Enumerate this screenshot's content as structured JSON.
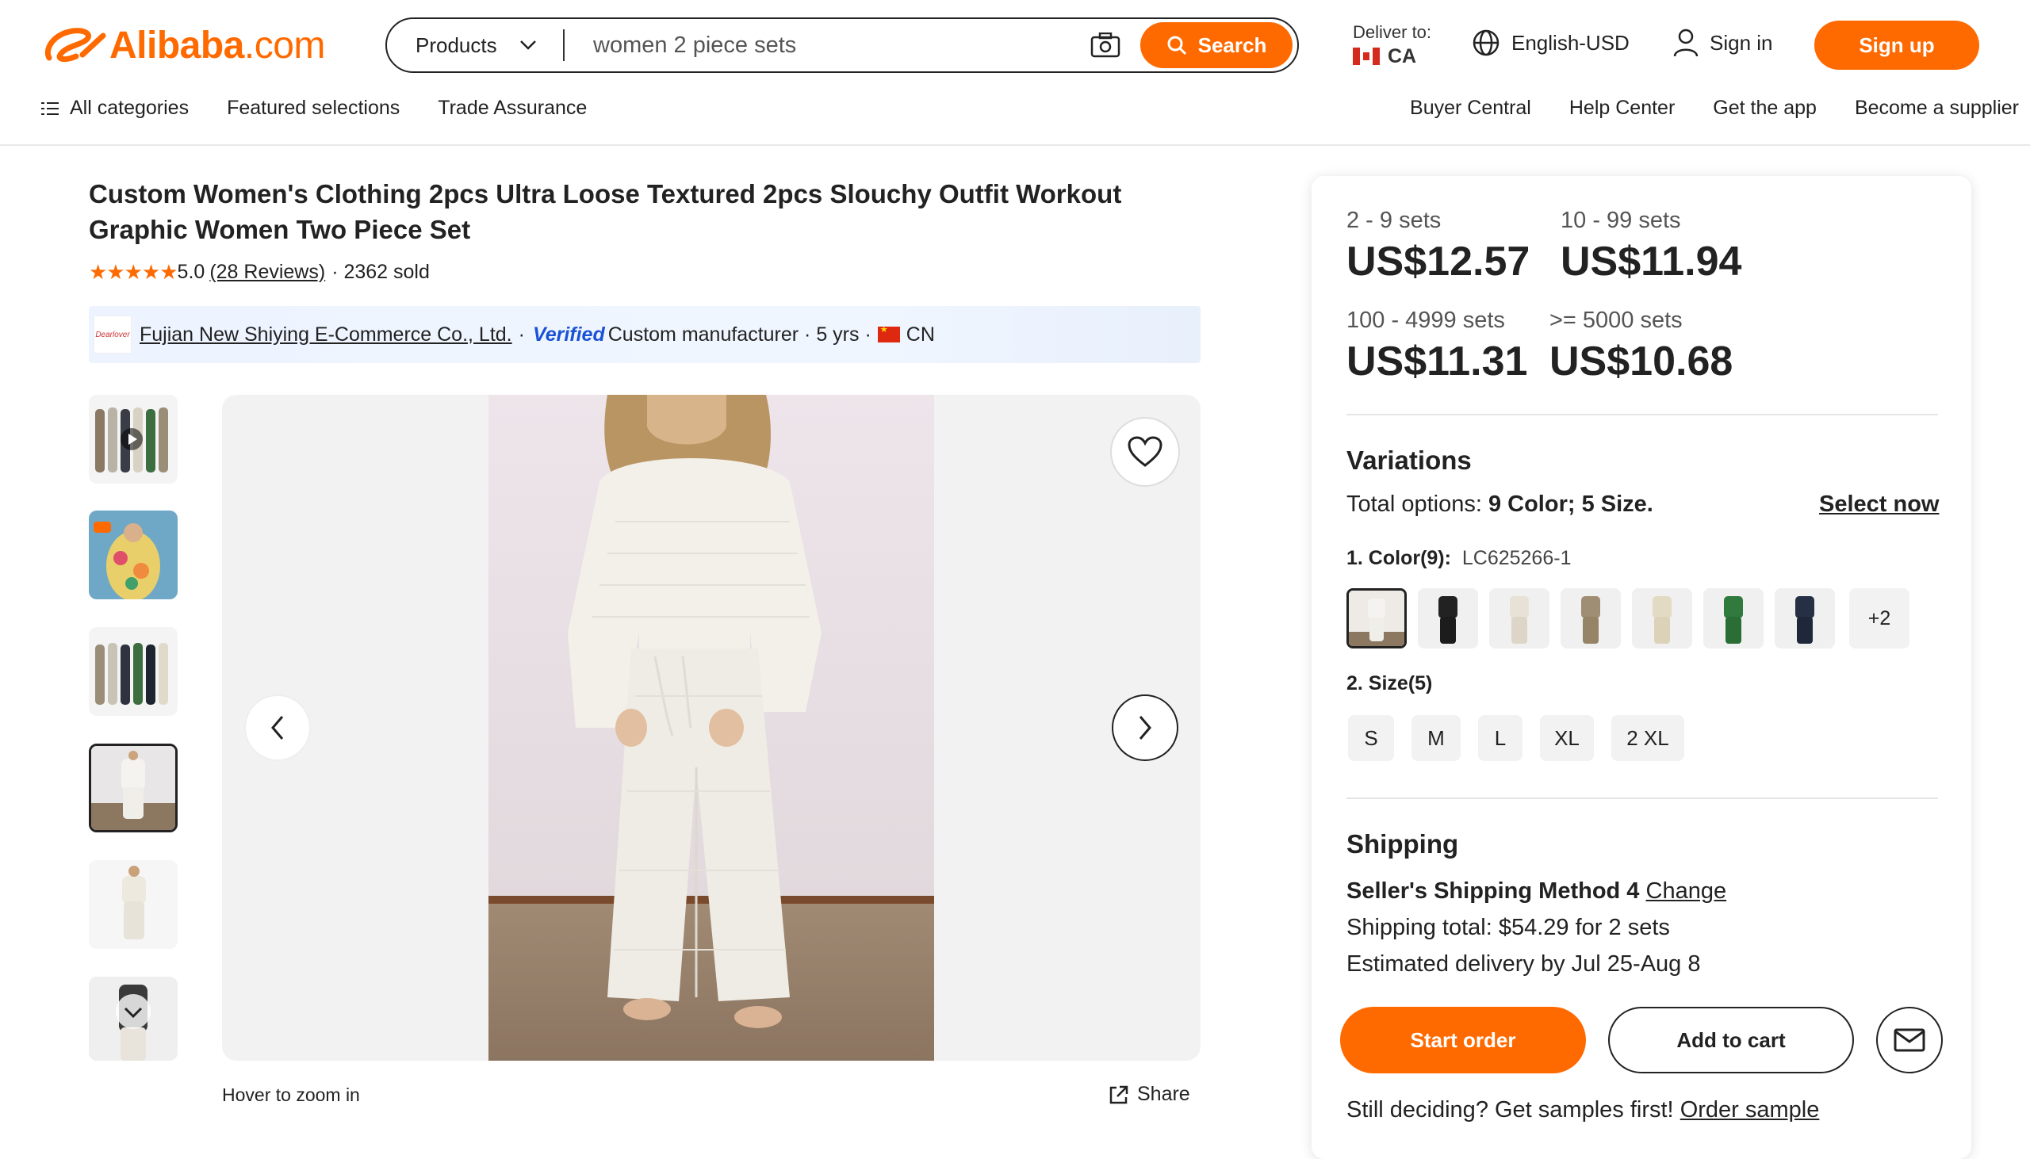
{
  "header": {
    "logo": "Alibaba",
    "logo_suffix": ".com",
    "search_category": "Products",
    "search_value": "women 2 piece sets",
    "search_button": "Search",
    "deliver_label": "Deliver to:",
    "deliver_country": "CA",
    "language": "English-USD",
    "sign_in": "Sign in",
    "sign_up": "Sign up"
  },
  "nav": {
    "all_categories": "All categories",
    "featured": "Featured selections",
    "trade": "Trade Assurance",
    "buyer_central": "Buyer Central",
    "help_center": "Help Center",
    "get_app": "Get the app",
    "become_supplier": "Become a supplier"
  },
  "product": {
    "title": "Custom Women's Clothing 2pcs Ultra Loose Textured 2pcs Slouchy Outfit Workout Graphic Women Two Piece Set",
    "rating": "5.0",
    "reviews": "(28 Reviews)",
    "sold": "· 2362 sold",
    "stars": "★★★★★"
  },
  "supplier": {
    "logo_text": "Dearlover",
    "name": "Fujian New Shiying E-Commerce Co., Ltd.",
    "sep1": "·",
    "verified": "Verified",
    "type": "Custom manufacturer · 5 yrs ·",
    "country": "CN"
  },
  "gallery": {
    "hover_zoom": "Hover to zoom in",
    "share": "Share"
  },
  "pricing": [
    {
      "range": "2 - 9 sets",
      "price": "US$12.57"
    },
    {
      "range": "10 - 99 sets",
      "price": "US$11.94"
    },
    {
      "range": "100 - 4999 sets",
      "price": "US$11.31"
    },
    {
      "range": ">= 5000 sets",
      "price": "US$10.68"
    }
  ],
  "variations": {
    "title": "Variations",
    "total_prefix": "Total options: ",
    "total_value": "9 Color; 5 Size.",
    "select_now": "Select now",
    "color_label": "1. Color(9):",
    "color_value": "LC625266-1",
    "more": "+2",
    "size_label": "2. Size(5)",
    "sizes": [
      "S",
      "M",
      "L",
      "XL",
      "2 XL"
    ]
  },
  "shipping": {
    "title": "Shipping",
    "method": "Seller's Shipping Method 4",
    "change": "Change",
    "total": "Shipping total: $54.29 for 2 sets",
    "delivery": "Estimated delivery by Jul 25-Aug 8"
  },
  "actions": {
    "start_order": "Start order",
    "add_to_cart": "Add to cart",
    "samples_text": "Still deciding? Get samples first!",
    "order_sample": "Order sample"
  },
  "colors": {
    "brand": "#ff6a00",
    "verified": "#1a52d6"
  }
}
